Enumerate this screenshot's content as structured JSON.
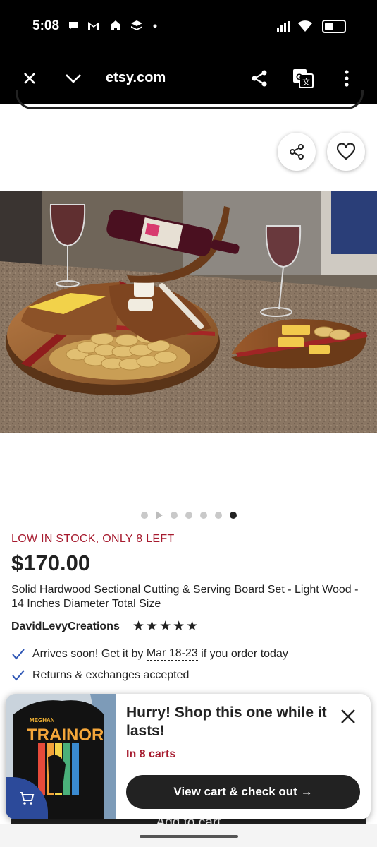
{
  "status_bar": {
    "time": "5:08",
    "icons": [
      "chat-icon",
      "gmail-icon",
      "home-icon",
      "layers-icon",
      "dot-icon"
    ],
    "signal": "signal-icon",
    "wifi": "wifi-icon",
    "battery": "battery-icon"
  },
  "browser": {
    "url": "etsy.com"
  },
  "listing": {
    "carousel_count": 7,
    "carousel_active": 7,
    "stock_notice": "LOW IN STOCK, ONLY 8 LEFT",
    "price": "$170.00",
    "title": "Solid Hardwood Sectional Cutting & Serving Board Set - Light Wood - 14 Inches Diameter Total Size",
    "shop_name": "DavidLevyCreations",
    "rating_stars": 5,
    "stars_text": "★★★★★",
    "arrives_prefix": "Arrives soon! Get it by ",
    "arrives_date": "Mar 18-23",
    "arrives_suffix": " if you order today",
    "returns": "Returns & exchanges accepted",
    "add_to_cart": "Add to cart"
  },
  "toast": {
    "headline": "Hurry! Shop this one while it lasts!",
    "carts": "In 8 carts",
    "button": "View cart & check out →",
    "shirt_text_top": "MEGHAN",
    "shirt_text_main": "TRAINOR"
  },
  "colors": {
    "accent_red": "#a61a2e",
    "dark": "#222222",
    "cart_badge": "#2c4a9a"
  }
}
